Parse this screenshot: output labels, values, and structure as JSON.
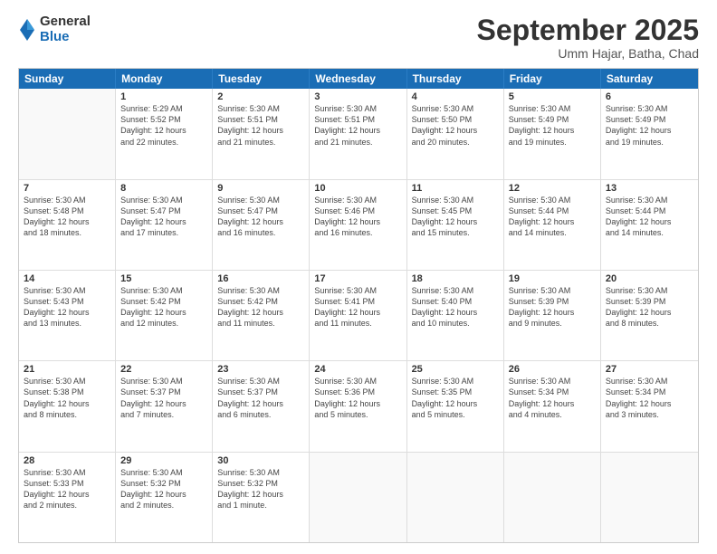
{
  "logo": {
    "general": "General",
    "blue": "Blue"
  },
  "title": "September 2025",
  "subtitle": "Umm Hajar, Batha, Chad",
  "header_days": [
    "Sunday",
    "Monday",
    "Tuesday",
    "Wednesday",
    "Thursday",
    "Friday",
    "Saturday"
  ],
  "weeks": [
    [
      {
        "day": "",
        "info": ""
      },
      {
        "day": "1",
        "info": "Sunrise: 5:29 AM\nSunset: 5:52 PM\nDaylight: 12 hours\nand 22 minutes."
      },
      {
        "day": "2",
        "info": "Sunrise: 5:30 AM\nSunset: 5:51 PM\nDaylight: 12 hours\nand 21 minutes."
      },
      {
        "day": "3",
        "info": "Sunrise: 5:30 AM\nSunset: 5:51 PM\nDaylight: 12 hours\nand 21 minutes."
      },
      {
        "day": "4",
        "info": "Sunrise: 5:30 AM\nSunset: 5:50 PM\nDaylight: 12 hours\nand 20 minutes."
      },
      {
        "day": "5",
        "info": "Sunrise: 5:30 AM\nSunset: 5:49 PM\nDaylight: 12 hours\nand 19 minutes."
      },
      {
        "day": "6",
        "info": "Sunrise: 5:30 AM\nSunset: 5:49 PM\nDaylight: 12 hours\nand 19 minutes."
      }
    ],
    [
      {
        "day": "7",
        "info": "Sunrise: 5:30 AM\nSunset: 5:48 PM\nDaylight: 12 hours\nand 18 minutes."
      },
      {
        "day": "8",
        "info": "Sunrise: 5:30 AM\nSunset: 5:47 PM\nDaylight: 12 hours\nand 17 minutes."
      },
      {
        "day": "9",
        "info": "Sunrise: 5:30 AM\nSunset: 5:47 PM\nDaylight: 12 hours\nand 16 minutes."
      },
      {
        "day": "10",
        "info": "Sunrise: 5:30 AM\nSunset: 5:46 PM\nDaylight: 12 hours\nand 16 minutes."
      },
      {
        "day": "11",
        "info": "Sunrise: 5:30 AM\nSunset: 5:45 PM\nDaylight: 12 hours\nand 15 minutes."
      },
      {
        "day": "12",
        "info": "Sunrise: 5:30 AM\nSunset: 5:44 PM\nDaylight: 12 hours\nand 14 minutes."
      },
      {
        "day": "13",
        "info": "Sunrise: 5:30 AM\nSunset: 5:44 PM\nDaylight: 12 hours\nand 14 minutes."
      }
    ],
    [
      {
        "day": "14",
        "info": "Sunrise: 5:30 AM\nSunset: 5:43 PM\nDaylight: 12 hours\nand 13 minutes."
      },
      {
        "day": "15",
        "info": "Sunrise: 5:30 AM\nSunset: 5:42 PM\nDaylight: 12 hours\nand 12 minutes."
      },
      {
        "day": "16",
        "info": "Sunrise: 5:30 AM\nSunset: 5:42 PM\nDaylight: 12 hours\nand 11 minutes."
      },
      {
        "day": "17",
        "info": "Sunrise: 5:30 AM\nSunset: 5:41 PM\nDaylight: 12 hours\nand 11 minutes."
      },
      {
        "day": "18",
        "info": "Sunrise: 5:30 AM\nSunset: 5:40 PM\nDaylight: 12 hours\nand 10 minutes."
      },
      {
        "day": "19",
        "info": "Sunrise: 5:30 AM\nSunset: 5:39 PM\nDaylight: 12 hours\nand 9 minutes."
      },
      {
        "day": "20",
        "info": "Sunrise: 5:30 AM\nSunset: 5:39 PM\nDaylight: 12 hours\nand 8 minutes."
      }
    ],
    [
      {
        "day": "21",
        "info": "Sunrise: 5:30 AM\nSunset: 5:38 PM\nDaylight: 12 hours\nand 8 minutes."
      },
      {
        "day": "22",
        "info": "Sunrise: 5:30 AM\nSunset: 5:37 PM\nDaylight: 12 hours\nand 7 minutes."
      },
      {
        "day": "23",
        "info": "Sunrise: 5:30 AM\nSunset: 5:37 PM\nDaylight: 12 hours\nand 6 minutes."
      },
      {
        "day": "24",
        "info": "Sunrise: 5:30 AM\nSunset: 5:36 PM\nDaylight: 12 hours\nand 5 minutes."
      },
      {
        "day": "25",
        "info": "Sunrise: 5:30 AM\nSunset: 5:35 PM\nDaylight: 12 hours\nand 5 minutes."
      },
      {
        "day": "26",
        "info": "Sunrise: 5:30 AM\nSunset: 5:34 PM\nDaylight: 12 hours\nand 4 minutes."
      },
      {
        "day": "27",
        "info": "Sunrise: 5:30 AM\nSunset: 5:34 PM\nDaylight: 12 hours\nand 3 minutes."
      }
    ],
    [
      {
        "day": "28",
        "info": "Sunrise: 5:30 AM\nSunset: 5:33 PM\nDaylight: 12 hours\nand 2 minutes."
      },
      {
        "day": "29",
        "info": "Sunrise: 5:30 AM\nSunset: 5:32 PM\nDaylight: 12 hours\nand 2 minutes."
      },
      {
        "day": "30",
        "info": "Sunrise: 5:30 AM\nSunset: 5:32 PM\nDaylight: 12 hours\nand 1 minute."
      },
      {
        "day": "",
        "info": ""
      },
      {
        "day": "",
        "info": ""
      },
      {
        "day": "",
        "info": ""
      },
      {
        "day": "",
        "info": ""
      }
    ]
  ]
}
